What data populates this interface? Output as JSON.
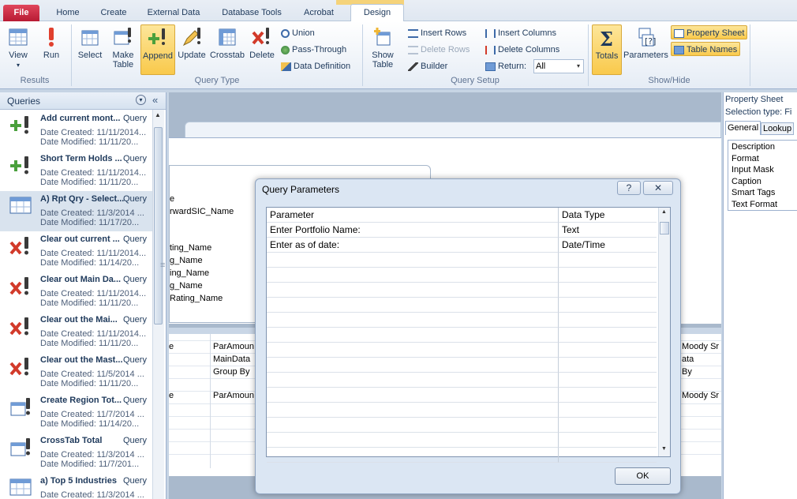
{
  "tabs": {
    "file": "File",
    "home": "Home",
    "create": "Create",
    "external": "External Data",
    "dbtools": "Database Tools",
    "acrobat": "Acrobat",
    "design": "Design"
  },
  "ribbon": {
    "results": {
      "view": "View",
      "run": "Run",
      "label": "Results"
    },
    "query_type": {
      "select": "Select",
      "make_table_1": "Make",
      "make_table_2": "Table",
      "append": "Append",
      "update": "Update",
      "crosstab": "Crosstab",
      "delete": "Delete",
      "union": "Union",
      "pass_through": "Pass-Through",
      "data_definition": "Data Definition",
      "label": "Query Type"
    },
    "query_setup": {
      "show_table_1": "Show",
      "show_table_2": "Table",
      "insert_rows": "Insert Rows",
      "delete_rows": "Delete Rows",
      "builder": "Builder",
      "insert_columns": "Insert Columns",
      "delete_columns": "Delete Columns",
      "return_label": "Return:",
      "return_value": "All",
      "label": "Query Setup"
    },
    "show_hide": {
      "totals": "Totals",
      "parameters": "Parameters",
      "property_sheet": "Property Sheet",
      "table_names": "Table Names",
      "label": "Show/Hide"
    }
  },
  "nav": {
    "title": "Queries",
    "items": [
      {
        "name": "Add current mont...",
        "type": "Query",
        "created": "Date Created: 11/11/2014...",
        "modified": "Date Modified: 11/11/20...",
        "icon": "append-query-icon"
      },
      {
        "name": "Short Term Holds ...",
        "type": "Query",
        "created": "Date Created: 11/11/2014...",
        "modified": "Date Modified: 11/11/20...",
        "icon": "append-query-icon"
      },
      {
        "name": "A) Rpt Qry - Select...",
        "type": "Query",
        "created": "Date Created: 11/3/2014 ...",
        "modified": "Date Modified: 11/17/20...",
        "icon": "select-query-icon"
      },
      {
        "name": "Clear out current ...",
        "type": "Query",
        "created": "Date Created: 11/11/2014...",
        "modified": "Date Modified: 11/14/20...",
        "icon": "delete-query-icon"
      },
      {
        "name": "Clear out Main Da...",
        "type": "Query",
        "created": "Date Created: 11/11/2014...",
        "modified": "Date Modified: 11/11/20...",
        "icon": "delete-query-icon"
      },
      {
        "name": "Clear out the Mai...",
        "type": "Query",
        "created": "Date Created: 11/11/2014...",
        "modified": "Date Modified: 11/11/20...",
        "icon": "delete-query-icon"
      },
      {
        "name": "Clear out the Mast...",
        "type": "Query",
        "created": "Date Created: 11/5/2014 ...",
        "modified": "Date Modified: 11/11/20...",
        "icon": "delete-query-icon"
      },
      {
        "name": "Create Region Tot...",
        "type": "Query",
        "created": "Date Created: 11/7/2014 ...",
        "modified": "Date Modified: 11/14/20...",
        "icon": "make-table-query-icon"
      },
      {
        "name": "CrossTab Total",
        "type": "Query",
        "created": "Date Created: 11/3/2014 ...",
        "modified": "Date Modified: 11/7/201...",
        "icon": "make-table-query-icon"
      },
      {
        "name": "a) Top 5 Industries",
        "type": "Query",
        "created": "Date Created: 11/3/2014 ...",
        "modified": "",
        "icon": "select-query-icon"
      }
    ]
  },
  "workspace": {
    "fields": [
      "e",
      "rwardSIC_Name",
      "ting_Name",
      "g_Name",
      "ing_Name",
      "g_Name",
      "Rating_Name"
    ],
    "grid_col1": [
      "e",
      "",
      "",
      "e"
    ],
    "grid_col2": [
      "ParAmoun",
      "MainData",
      "Group By",
      "ParAmoun"
    ],
    "grid_col3": [
      "Moody Sr",
      "ata",
      "By",
      "Moody Sr"
    ]
  },
  "property_sheet": {
    "title": "Property Sheet",
    "selection": "Selection type: Fi",
    "tab_general": "General",
    "tab_lookup": "Lookup",
    "props": [
      "Description",
      "Format",
      "Input Mask",
      "Caption",
      "Smart Tags",
      "Text Format"
    ]
  },
  "dialog": {
    "title": "Query Parameters",
    "help": "?",
    "close": "✕",
    "col_parameter": "Parameter",
    "col_datatype": "Data Type",
    "rows": [
      {
        "parameter": "Enter Portfolio Name:",
        "datatype": "Text"
      },
      {
        "parameter": "Enter as of date:",
        "datatype": "Date/Time"
      }
    ],
    "ok": "OK"
  }
}
